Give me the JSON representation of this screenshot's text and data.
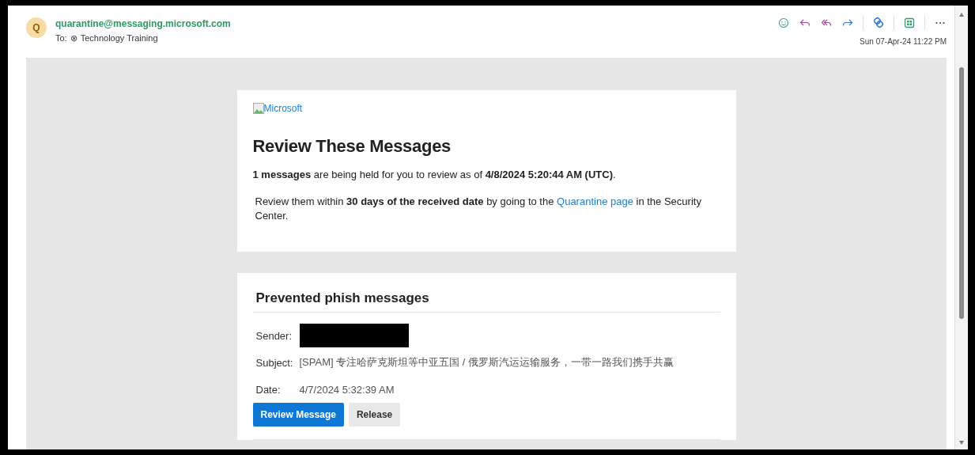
{
  "header": {
    "avatar_initial": "Q",
    "sender": "quarantine@messaging.microsoft.com",
    "to_label": "To:",
    "recipient_mark": "⊗",
    "recipient": "Technology Training",
    "date": "Sun 07-Apr-24 11:22 PM",
    "toolbar": [
      {
        "kind": "emoji"
      },
      {
        "kind": "reply"
      },
      {
        "kind": "reply_all"
      },
      {
        "kind": "forward"
      },
      {
        "kind": "loop"
      },
      {
        "kind": "apps"
      },
      {
        "kind": "more"
      }
    ]
  },
  "summary": {
    "logo_alt": "Microsoft",
    "title": "Review These Messages",
    "intro": " **1 messages** are being held for you to review as of **4/8/2024 5:20:44 AM (UTC)**.",
    "instruction_before": " Review them within **30 days of the received date** by going to the ",
    "instruction_link": "Quarantine page",
    "instruction_after": " in the Security Center."
  },
  "phish": {
    "title": "Prevented phish messages",
    "fields": [
      {
        "label": "Sender:",
        "kind": "redacted"
      },
      {
        "label": "Subject:",
        "kind": "text",
        "value": "[SPAM] 专注哈萨克斯坦等中亚五国 / 俄罗斯汽运运输服务，一带一路我们携手共赢"
      },
      {
        "label": "Date:",
        "kind": "text",
        "value": "4/7/2024 5:32:39 AM"
      }
    ],
    "buttons": [
      {
        "label": "Review Message",
        "kind": "primary"
      },
      {
        "label": "Release",
        "kind": "secondary"
      }
    ]
  }
}
